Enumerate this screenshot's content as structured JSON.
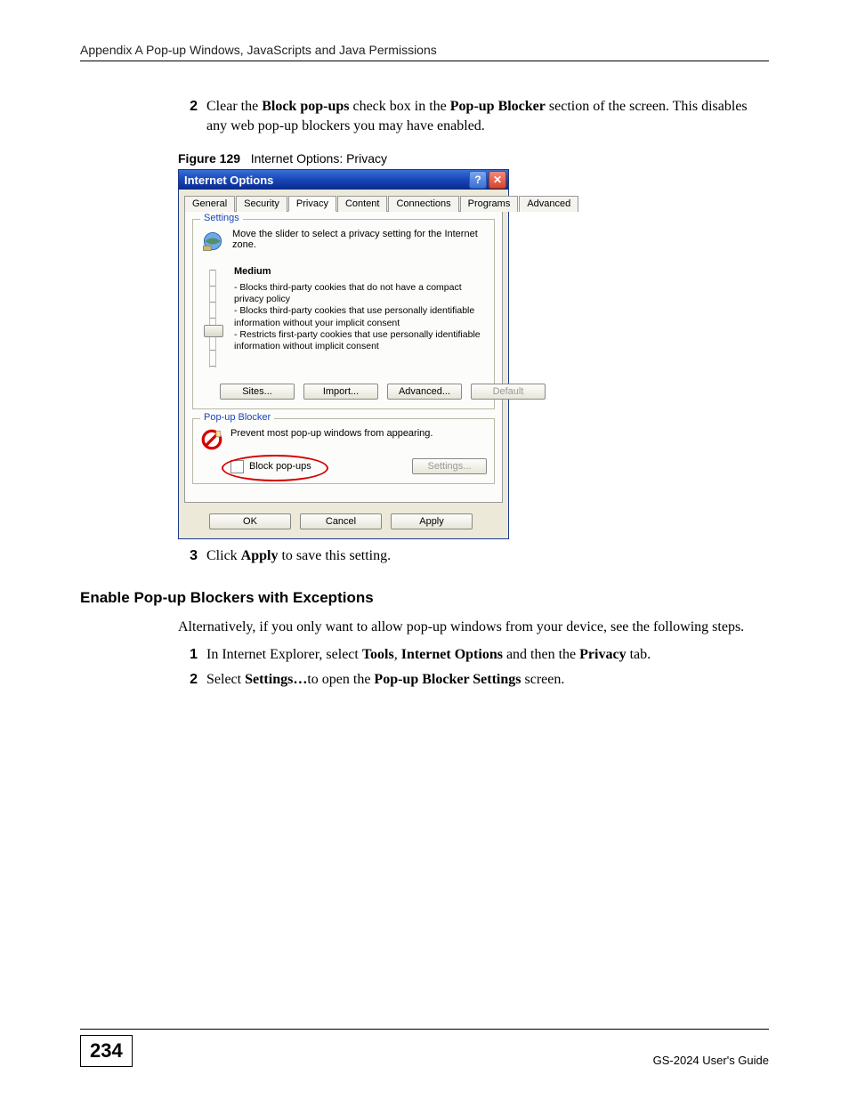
{
  "header": "Appendix A Pop-up Windows, JavaScripts and Java Permissions",
  "step2": {
    "num": "2",
    "pre": "Clear the ",
    "b1": "Block pop-ups",
    "mid1": " check box in the ",
    "b2": "Pop-up Blocker",
    "mid2": " section of the screen. This disables any web pop-up blockers you may have enabled."
  },
  "figure": {
    "label": "Figure 129",
    "caption": "Internet Options: Privacy"
  },
  "dialog": {
    "title": "Internet Options",
    "tabs": [
      "General",
      "Security",
      "Privacy",
      "Content",
      "Connections",
      "Programs",
      "Advanced"
    ],
    "activeTab": 2,
    "settings": {
      "group": "Settings",
      "intro": "Move the slider to select a privacy setting for the Internet zone.",
      "level": "Medium",
      "bullet1": "- Blocks third-party cookies that do not have a compact privacy policy",
      "bullet2": "- Blocks third-party cookies that use personally identifiable information without your implicit consent",
      "bullet3": "- Restricts first-party cookies that use personally identifiable information without implicit consent",
      "buttons": {
        "sites": "Sites...",
        "import": "Import...",
        "advanced": "Advanced...",
        "default": "Default"
      }
    },
    "popup": {
      "group": "Pop-up Blocker",
      "desc": "Prevent most pop-up windows from appearing.",
      "checkbox": "Block pop-ups",
      "settings": "Settings..."
    },
    "bottom": {
      "ok": "OK",
      "cancel": "Cancel",
      "apply": "Apply"
    }
  },
  "step3": {
    "num": "3",
    "pre": "Click ",
    "b1": "Apply",
    "post": " to save this setting."
  },
  "subhead": "Enable Pop-up Blockers with Exceptions",
  "para": "Alternatively, if you only want to allow pop-up windows from your device, see the following steps.",
  "stepA": {
    "num": "1",
    "pre": "In Internet Explorer, select ",
    "b1": "Tools",
    "sep1": ", ",
    "b2": "Internet Options",
    "mid": " and then the ",
    "b3": "Privacy",
    "post": " tab."
  },
  "stepB": {
    "num": "2",
    "pre": "Select ",
    "b1": "Settings…",
    "mid": "to open the ",
    "b2": "Pop-up Blocker Settings",
    "post": " screen."
  },
  "footer": {
    "page": "234",
    "guide": "GS-2024 User's Guide"
  }
}
